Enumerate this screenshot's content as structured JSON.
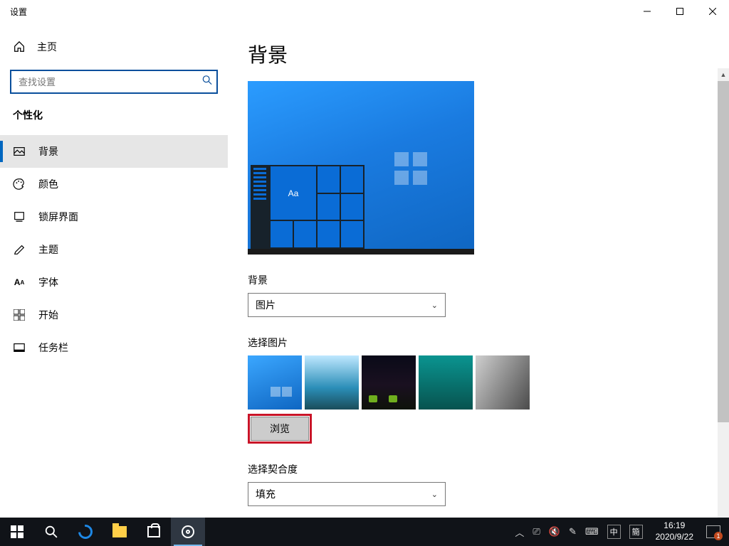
{
  "window": {
    "title": "设置"
  },
  "sidebar": {
    "home": "主页",
    "search_placeholder": "查找设置",
    "section": "个性化",
    "items": [
      {
        "label": "背景"
      },
      {
        "label": "颜色"
      },
      {
        "label": "锁屏界面"
      },
      {
        "label": "主题"
      },
      {
        "label": "字体"
      },
      {
        "label": "开始"
      },
      {
        "label": "任务栏"
      }
    ]
  },
  "page": {
    "title": "背景",
    "preview_sample_text": "Aa",
    "bg_label": "背景",
    "bg_value": "图片",
    "choose_label": "选择图片",
    "browse": "浏览",
    "fit_label": "选择契合度",
    "fit_value": "填充"
  },
  "taskbar": {
    "time": "16:19",
    "date": "2020/9/22",
    "ime1": "中",
    "ime2": "簡",
    "notif_count": "1"
  }
}
